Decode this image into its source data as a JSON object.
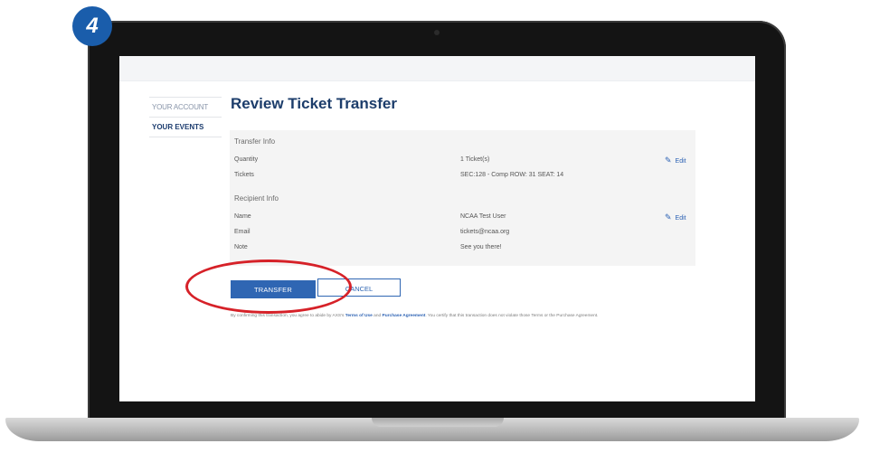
{
  "step_number": "4",
  "page_title": "Review Ticket Transfer",
  "sidebar": {
    "items": [
      {
        "label": "YOUR ACCOUNT"
      },
      {
        "label": "YOUR EVENTS"
      }
    ]
  },
  "transfer_info": {
    "heading": "Transfer Info",
    "rows": [
      {
        "label": "Quantity",
        "value": "1 Ticket(s)",
        "edit": "Edit"
      },
      {
        "label": "Tickets",
        "value": "SEC:128 - Comp ROW: 31 SEAT: 14"
      }
    ]
  },
  "recipient_info": {
    "heading": "Recipient Info",
    "rows": [
      {
        "label": "Name",
        "value": "NCAA Test User",
        "edit": "Edit"
      },
      {
        "label": "Email",
        "value": "tickets@ncaa.org"
      },
      {
        "label": "Note",
        "value": "See you there!"
      }
    ]
  },
  "actions": {
    "transfer_label": "TRANSFER",
    "cancel_label": "CANCEL"
  },
  "legal": {
    "prefix": "By confirming this transaction, you agree to abide by AXS's",
    "terms_link": "Terms of Use",
    "and": "and",
    "purchase_link": "Purchase Agreement",
    "suffix": ". You certify that this transaction does not violate those Terms or the Purchase Agreement."
  },
  "colors": {
    "primary": "#2f66b3",
    "title": "#1c3d6b",
    "highlight": "#d62128",
    "badge": "#1a5dab"
  }
}
